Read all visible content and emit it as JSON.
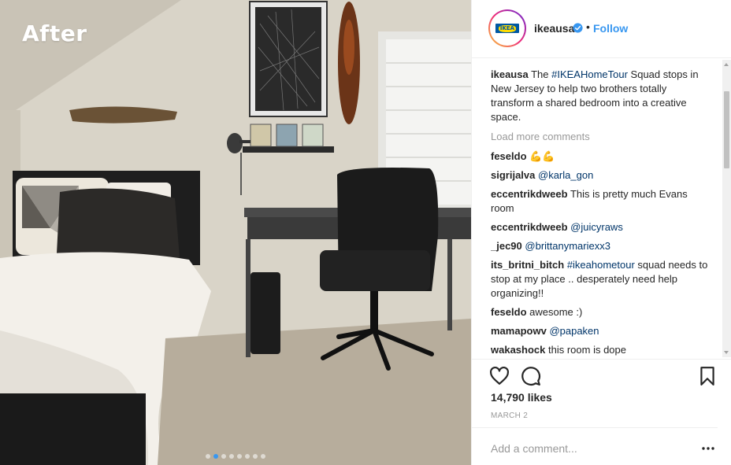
{
  "photo": {
    "overlay_text": "After",
    "slides": 8,
    "active_slide": 1
  },
  "post": {
    "username": "ikeausa",
    "separator": "•",
    "follow_label": "Follow",
    "caption_user": "ikeausa",
    "caption_pre": "The ",
    "caption_tag": "#IKEAHomeTour",
    "caption_post": " Squad stops in New Jersey to help two brothers totally transform a shared bedroom into a creative space.",
    "load_more": "Load more comments",
    "comments": [
      {
        "user": "feseldo",
        "text": "💪💪"
      },
      {
        "user": "sigrijalva",
        "mention": "@karla_gon"
      },
      {
        "user": "eccentrikdweeb",
        "text": "This is pretty much Evans room"
      },
      {
        "user": "eccentrikdweeb",
        "mention": "@juicyraws"
      },
      {
        "user": "_jec90",
        "mention": "@brittanymariexx3"
      },
      {
        "user": "its_britni_bitch",
        "tag": "#ikeahometour",
        "text": " squad needs to stop at my place .. desperately need help organizing!!"
      },
      {
        "user": "feseldo",
        "text": "awesome :)"
      },
      {
        "user": "mamapowv",
        "mention": "@papaken"
      },
      {
        "user": "wakashock",
        "text": "this room is dope"
      }
    ],
    "likes": "14,790 likes",
    "date": "MARCH 2",
    "add_comment_placeholder": "Add a comment...",
    "icons": [
      "heart-icon",
      "comment-icon",
      "bookmark-icon",
      "more-icon",
      "verified-icon"
    ],
    "colors": {
      "link": "#3897f0",
      "tag": "#003569",
      "muted": "#999999",
      "text": "#262626"
    }
  }
}
